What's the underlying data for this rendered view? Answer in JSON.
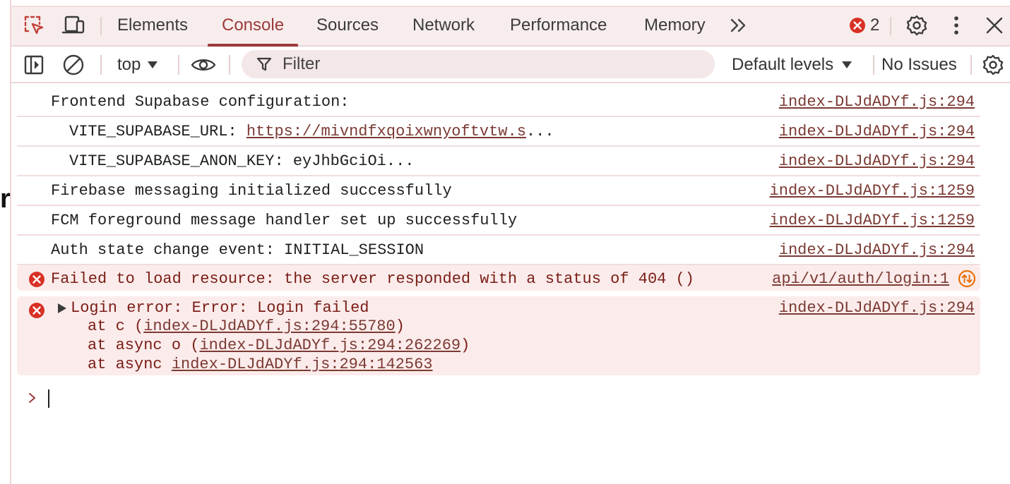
{
  "page": {
    "edge_char": "r"
  },
  "tabs": [
    {
      "label": "Elements",
      "active": false
    },
    {
      "label": "Console",
      "active": true
    },
    {
      "label": "Sources",
      "active": false
    },
    {
      "label": "Network",
      "active": false
    },
    {
      "label": "Performance",
      "active": false
    },
    {
      "label": "Memory",
      "active": false
    }
  ],
  "header": {
    "error_count": "2"
  },
  "toolbar": {
    "context": "top",
    "filter_placeholder": "Filter",
    "levels": "Default levels",
    "issues": "No Issues"
  },
  "logs": [
    {
      "message": "Frontend Supabase configuration:",
      "source": "index-DLJdADYf.js:294"
    },
    {
      "label": "VITE_SUPABASE_URL: ",
      "link": "https://mivndfxqoixwnyoftvtw.s",
      "suffix": "...",
      "source": "index-DLJdADYf.js:294"
    },
    {
      "message": "VITE_SUPABASE_ANON_KEY: eyJhbGciOi...",
      "source": "index-DLJdADYf.js:294"
    },
    {
      "message": "Firebase messaging initialized successfully",
      "source": "index-DLJdADYf.js:1259"
    },
    {
      "message": "FCM foreground message handler set up successfully",
      "source": "index-DLJdADYf.js:1259"
    },
    {
      "message": "Auth state change event: INITIAL_SESSION",
      "source": "index-DLJdADYf.js:294"
    }
  ],
  "errors": [
    {
      "message": "Failed to load resource: the server responded with a status of 404 ()",
      "source": "api/v1/auth/login:1"
    },
    {
      "message": "Login error: Error: Login failed",
      "source": "index-DLJdADYf.js:294",
      "stack": [
        {
          "prefix": "at c (",
          "link": "index-DLJdADYf.js:294:55780",
          "suffix": ")"
        },
        {
          "prefix": "at async o (",
          "link": "index-DLJdADYf.js:294:262269",
          "suffix": ")"
        },
        {
          "prefix": "at async ",
          "link": "index-DLJdADYf.js:294:142563",
          "suffix": ""
        }
      ]
    }
  ],
  "colors": {
    "accent": "#9c3a3a",
    "error": "#d93025",
    "error_bg": "#fbeceb",
    "link": "#7b3a34"
  }
}
